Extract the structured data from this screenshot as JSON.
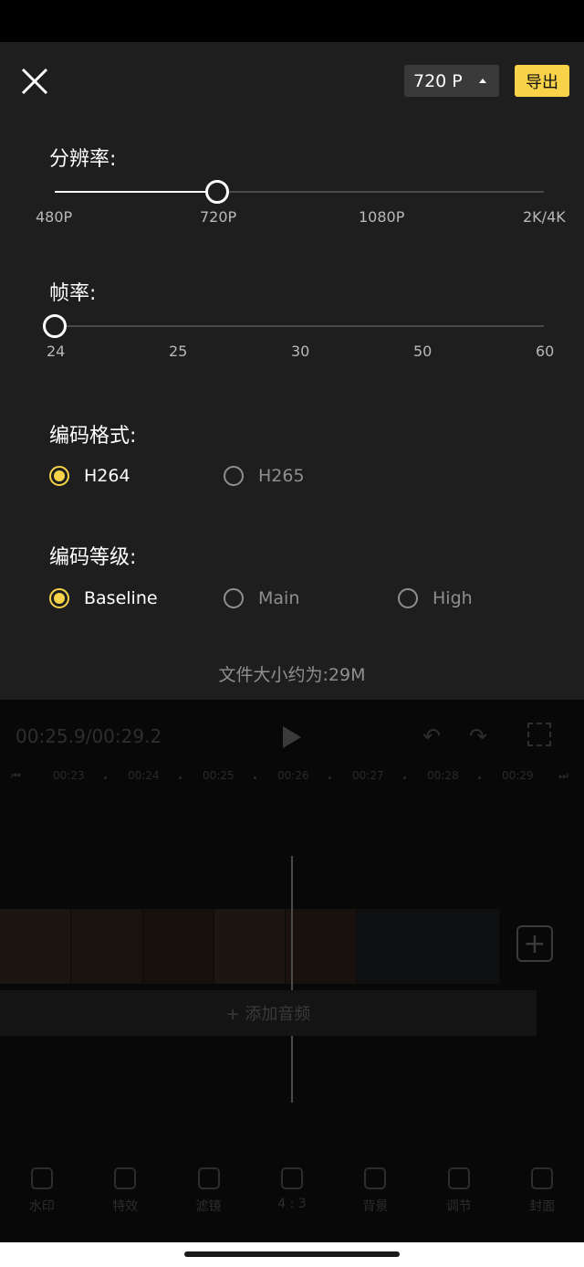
{
  "header": {
    "resolution_value": "720 P",
    "export_label": "导出"
  },
  "resolution": {
    "label": "分辨率:",
    "ticks": [
      "480P",
      "720P",
      "1080P",
      "2K/4K"
    ],
    "selected_index": 1
  },
  "framerate": {
    "label": "帧率:",
    "ticks": [
      "24",
      "25",
      "30",
      "50",
      "60"
    ],
    "selected_index": 0
  },
  "codec_format": {
    "label": "编码格式:",
    "options": [
      "H264",
      "H265"
    ],
    "selected_index": 0
  },
  "codec_level": {
    "label": "编码等级:",
    "options": [
      "Baseline",
      "Main",
      "High"
    ],
    "selected_index": 0
  },
  "file_size": "文件大小约为:29M",
  "editor": {
    "timecode": "00:25.9/00:29.2",
    "ruler": [
      "00:23",
      "00:24",
      "00:25",
      "00:26",
      "00:27",
      "00:28",
      "00:29"
    ],
    "add_audio": "+ 添加音频",
    "tools": [
      "水印",
      "特效",
      "滤镜",
      "4 : 3",
      "背景",
      "调节",
      "封面"
    ]
  },
  "colors": {
    "accent": "#f8d349",
    "panel_bg": "#1e1e1e"
  }
}
